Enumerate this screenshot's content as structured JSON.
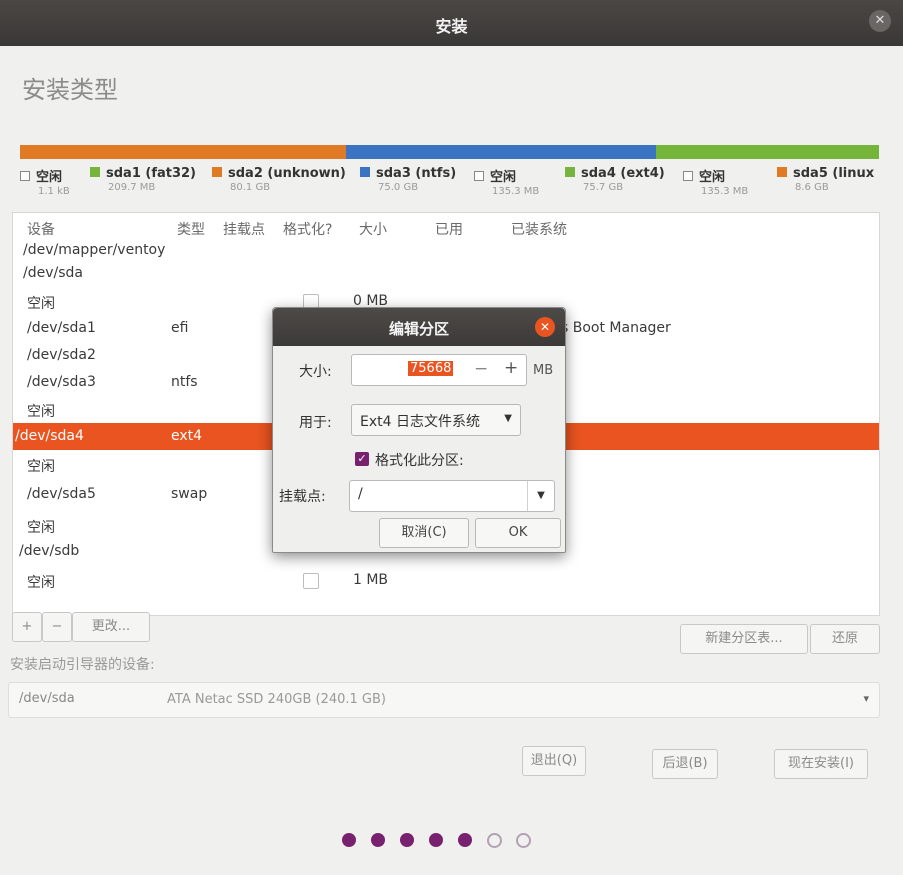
{
  "window": {
    "title": "安装",
    "close": "✕"
  },
  "page": {
    "heading": "安装类型"
  },
  "partition_bar": [
    {
      "color": "#e07a25",
      "fraction": 0.38
    },
    {
      "color": "#3b74c2",
      "fraction": 0.36
    },
    {
      "color": "#76b53c",
      "fraction": 0.26
    }
  ],
  "legend": [
    {
      "name": "空闲",
      "size": "1.1 kB",
      "color": "empty"
    },
    {
      "name": "sda1 (fat32)",
      "size": "209.7 MB",
      "color": "#76b53c"
    },
    {
      "name": "sda2 (unknown)",
      "size": "80.1 GB",
      "color": "#e07a25"
    },
    {
      "name": "sda3 (ntfs)",
      "size": "75.0 GB",
      "color": "#3b74c2"
    },
    {
      "name": "空闲",
      "size": "135.3 MB",
      "color": "empty"
    },
    {
      "name": "sda4 (ext4)",
      "size": "75.7 GB",
      "color": "#76b53c"
    },
    {
      "name": "空闲",
      "size": "135.3 MB",
      "color": "empty"
    },
    {
      "name": "sda5 (linux",
      "size": "8.6 GB",
      "color": "#e07a25"
    }
  ],
  "table": {
    "headers": [
      "设备",
      "类型",
      "挂载点",
      "格式化?",
      "大小",
      "已用",
      "已装系统"
    ],
    "rows": [
      {
        "device": "/dev/mapper/ventoy",
        "type": "",
        "size": "",
        "system": ""
      },
      {
        "device": "/dev/sda",
        "type": "",
        "size": "",
        "system": ""
      },
      {
        "device": "空闲",
        "type": "",
        "size": "0 MB",
        "system": ""
      },
      {
        "device": "/dev/sda1",
        "type": "efi",
        "size": "",
        "system": "s Boot Manager"
      },
      {
        "device": "/dev/sda2",
        "type": "",
        "size": "",
        "system": ""
      },
      {
        "device": "/dev/sda3",
        "type": "ntfs",
        "size": "",
        "system": ""
      },
      {
        "device": "空闲",
        "type": "",
        "size": "",
        "system": ""
      },
      {
        "device": "/dev/sda4",
        "type": "ext4",
        "size": "",
        "system": ""
      },
      {
        "device": "空闲",
        "type": "",
        "size": "",
        "system": ""
      },
      {
        "device": "/dev/sda5",
        "type": "swap",
        "size": "",
        "system": ""
      },
      {
        "device": "空闲",
        "type": "",
        "size": "",
        "system": ""
      },
      {
        "device": "/dev/sdb",
        "type": "",
        "size": "",
        "system": ""
      },
      {
        "device": "空闲",
        "type": "",
        "size": "1 MB",
        "system": ""
      }
    ]
  },
  "table_buttons": {
    "add": "+",
    "remove": "−",
    "change": "更改...",
    "new_table": "新建分区表...",
    "revert": "还原"
  },
  "boot": {
    "label": "安装启动引导器的设备:",
    "device": "/dev/sda",
    "description": "ATA Netac SSD 240GB (240.1 GB)"
  },
  "nav_buttons": {
    "quit": "退出(Q)",
    "back": "后退(B)",
    "install": "现在安装(I)"
  },
  "progress": {
    "total": 7,
    "completed": 5
  },
  "dialog": {
    "title": "编辑分区",
    "size_label": "大小:",
    "size_value": "75668",
    "size_minus": "−",
    "size_plus": "+",
    "size_unit": "MB",
    "use_label": "用于:",
    "use_value": "Ext4 日志文件系统",
    "format_label": "格式化此分区:",
    "format_checked": true,
    "mount_label": "挂载点:",
    "mount_value": "/",
    "cancel": "取消(C)",
    "ok": "OK"
  }
}
